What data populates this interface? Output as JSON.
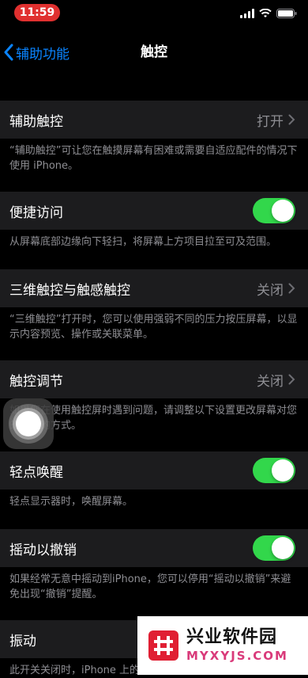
{
  "status_bar": {
    "time": "11:59"
  },
  "nav": {
    "back_label": "辅助功能",
    "title": "触控"
  },
  "rows": [
    {
      "label": "辅助触控",
      "value": "打开"
    },
    {
      "label": "便捷访问",
      "toggle": true
    },
    {
      "label": "三维触控与触感触控",
      "value": "关闭"
    },
    {
      "label": "触控调节",
      "value": "关闭"
    },
    {
      "label": "轻点唤醒",
      "toggle": true
    },
    {
      "label": "摇动以撤销",
      "toggle": true
    },
    {
      "label": "振动"
    }
  ],
  "footers": [
    "“辅助触控”可让您在触摸屏幕有困难或需要自适应配件的情况下使用 iPhone。",
    "从屏幕底部边缘向下轻扫，将屏幕上方项目拉至可及范围。",
    "“三维触控”打开时，您可以使用强弱不同的压力按压屏幕，以显示内容预览、操作或关联菜单。",
    "如果您在使用触控屏时遇到问题，请调整以下设置更改屏幕对您的操作的方式。",
    "轻点显示器时，唤醒屏幕。",
    "如果经常无意中摇动到iPhone，您可以停用“摇动以撤销”来避免出现“撤销”提醒。",
    "此开关关闭时，iPhone 上的"
  ],
  "watermark": {
    "cn": "兴业软件园",
    "en": "MYXYJS.COM"
  },
  "colors": {
    "accent": "#0a84ff",
    "toggle_on": "#32d74b",
    "cell_bg": "#1c1c1e",
    "secondary_text": "#8e8e93"
  }
}
